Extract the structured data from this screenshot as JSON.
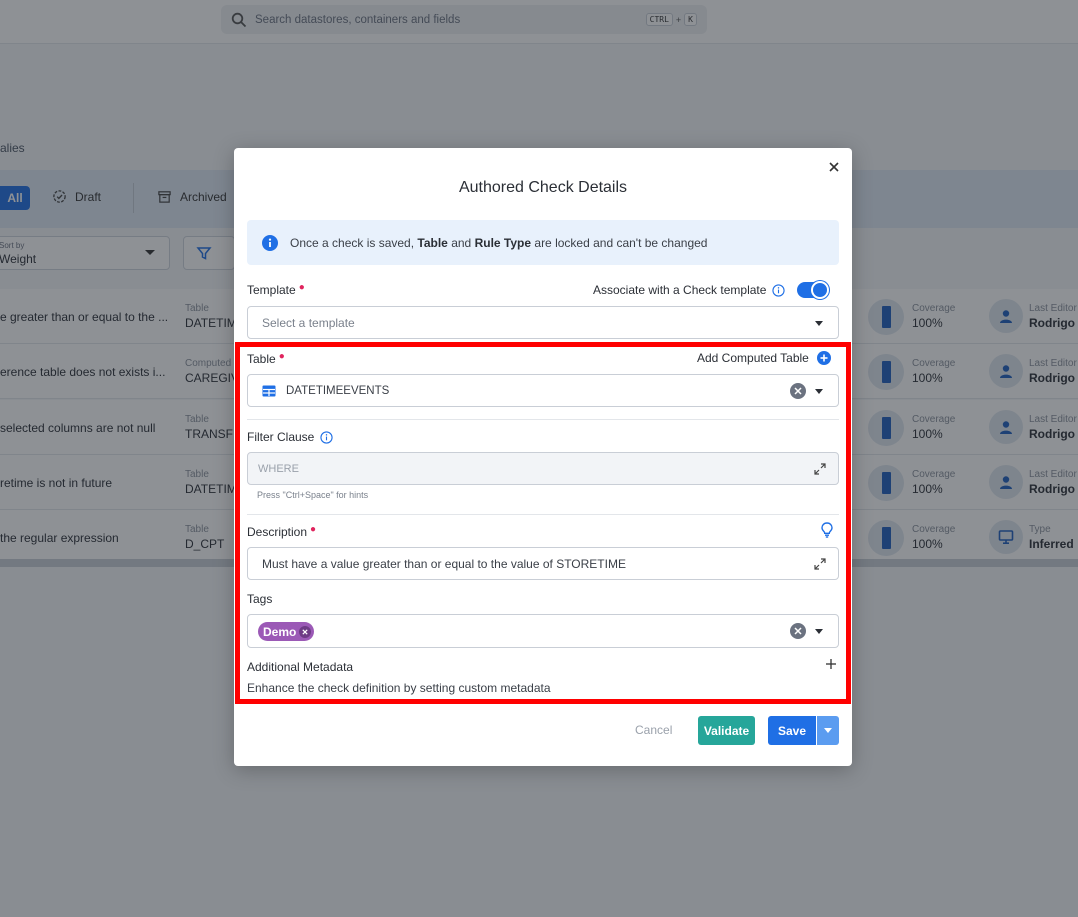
{
  "search": {
    "placeholder": "Search datastores, containers and fields",
    "kbd_ctrl": "CTRL",
    "kbd_plus": "+",
    "kbd_k": "K"
  },
  "background": {
    "crumb": "alies",
    "tabs": {
      "all": "All",
      "draft": "Draft",
      "archived": "Archived"
    },
    "sort": {
      "label": "Sort by",
      "value": "Weight"
    },
    "rows": [
      {
        "title": "e greater than or equal to the ...",
        "col_label": "Table",
        "col_value": "DATETIM",
        "cov_label": "Coverage",
        "cov_value": "100%",
        "ed_label": "Last Editor",
        "ed_value": "Rodrigo",
        "ed_icon": "user-icon"
      },
      {
        "title": "erence table does not exists i...",
        "col_label": "Computed",
        "col_value": "CAREGIV",
        "cov_label": "Coverage",
        "cov_value": "100%",
        "ed_label": "Last Editor",
        "ed_value": "Rodrigo",
        "ed_icon": "user-icon"
      },
      {
        "title": "selected columns are not null",
        "col_label": "Table",
        "col_value": "TRANSFE",
        "cov_label": "Coverage",
        "cov_value": "100%",
        "ed_label": "Last Editor",
        "ed_value": "Rodrigo",
        "ed_icon": "user-icon"
      },
      {
        "title": "retime is not in future",
        "col_label": "Table",
        "col_value": "DATETIM",
        "cov_label": "Coverage",
        "cov_value": "100%",
        "ed_label": "Last Editor",
        "ed_value": "Rodrigo",
        "ed_icon": "user-icon"
      },
      {
        "title": "the regular expression",
        "col_label": "Table",
        "col_value": "D_CPT",
        "cov_label": "Coverage",
        "cov_value": "100%",
        "ed_label": "Type",
        "ed_value": "Inferred",
        "ed_icon": "monitor-icon"
      }
    ]
  },
  "modal": {
    "title": "Authored Check Details",
    "info": {
      "prefix": "Once a check is saved,",
      "b1": "Table",
      "mid": "and",
      "b2": "Rule Type",
      "suffix": "are locked and can't be changed"
    },
    "template": {
      "label": "Template",
      "assoc_label": "Associate with a Check template",
      "assoc_on": true,
      "placeholder": "Select a template"
    },
    "table": {
      "label": "Table",
      "add_computed": "Add Computed Table",
      "value": "DATETIMEEVENTS"
    },
    "filter": {
      "label": "Filter Clause",
      "placeholder": "WHERE",
      "hint": "Press \"Ctrl+Space\" for hints"
    },
    "description": {
      "label": "Description",
      "value": "Must have a value greater than or equal to the value of STORETIME"
    },
    "tags": {
      "label": "Tags",
      "items": [
        "Demo"
      ]
    },
    "metadata": {
      "label": "Additional Metadata",
      "sub": "Enhance the check definition by setting custom metadata"
    },
    "actions": {
      "cancel": "Cancel",
      "validate": "Validate",
      "save": "Save"
    }
  },
  "colors": {
    "accent": "#1f6fe5",
    "validate": "#26a69a",
    "tag": "#9b59b6",
    "highlight": "#ff0000"
  }
}
